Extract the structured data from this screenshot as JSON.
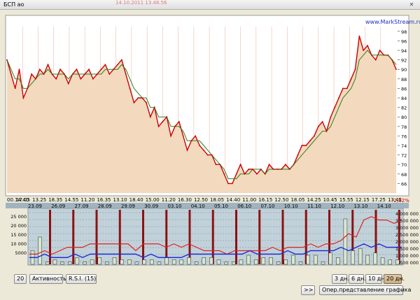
{
  "window": {
    "title": "БСП ао",
    "subtitle": "14.10.2011  13.48.56"
  },
  "brand": "www.MarkStream.ru",
  "colors": {
    "price_fill": "#f3d9bd",
    "price_line": "#cc0000",
    "ma_line": "#2e7d1e",
    "panel_bg": "#bfd0d8",
    "vol_line": "#1f2fd6",
    "act_line": "#e02020"
  },
  "price_chart": {
    "y_ticks": [
      "98",
      "96",
      "94",
      "92",
      "90",
      "88",
      "86",
      "84",
      "82",
      "80",
      "78",
      "76",
      "74",
      "72",
      "70",
      "68",
      "66"
    ],
    "x_ticks": [
      "00.14.40",
      "17.05",
      "13.25",
      "18.35",
      "14.55",
      "11.20",
      "16.35",
      "13.10",
      "18.40",
      "15.00",
      "11.20",
      "16.30",
      "12.50",
      "18.05",
      "14.40",
      "11.00",
      "16.15",
      "12.50",
      "18.05",
      "14.25",
      "10.45",
      "15.55",
      "12.15",
      "17.25",
      "13.45"
    ],
    "change_label": "-2,82%"
  },
  "chart_data": {
    "type": "line",
    "title": "",
    "ylim": [
      64,
      99
    ],
    "series": [
      {
        "name": "",
        "values": [
          92,
          89,
          86,
          90,
          84,
          86,
          89,
          88,
          90,
          89,
          91,
          89,
          88,
          90,
          89,
          87,
          89,
          90,
          88,
          89,
          90,
          88,
          89,
          90,
          91,
          89,
          90,
          91,
          92,
          89,
          86,
          83,
          84,
          84,
          83,
          80,
          82,
          78,
          79,
          80,
          76,
          78,
          79,
          76,
          73,
          75,
          76,
          74,
          73,
          72,
          72,
          70,
          70,
          68,
          66,
          66,
          68,
          70,
          68,
          69,
          69,
          68,
          69,
          68,
          70,
          69,
          69,
          69,
          70,
          69,
          70,
          72,
          74,
          74,
          75,
          76,
          78,
          79,
          77,
          80,
          82,
          84,
          86,
          86,
          88,
          90,
          97,
          94,
          95,
          93,
          92,
          94,
          93,
          93,
          92,
          90
        ]
      },
      {
        "name": "",
        "values": [
          92,
          90,
          88,
          88,
          86,
          86,
          87,
          88,
          89,
          89,
          90,
          89,
          89,
          89,
          89,
          88,
          89,
          89,
          89,
          89,
          89,
          89,
          89,
          89,
          90,
          90,
          90,
          90,
          91,
          90,
          88,
          86,
          85,
          84,
          84,
          82,
          82,
          80,
          80,
          80,
          78,
          78,
          78,
          77,
          75,
          75,
          75,
          75,
          74,
          73,
          72,
          71,
          70,
          69,
          67,
          67,
          67,
          68,
          68,
          68,
          69,
          69,
          69,
          68,
          69,
          69,
          69,
          69,
          69,
          69,
          70,
          71,
          72,
          73,
          74,
          75,
          76,
          77,
          77,
          78,
          80,
          82,
          84,
          85,
          86,
          88,
          92,
          93,
          94,
          93,
          93,
          93,
          93,
          93,
          92,
          91
        ]
      }
    ],
    "lower_panel": {
      "dates": [
        "23.09",
        "26.09",
        "27.09",
        "28.09",
        "29.09",
        "30.09",
        "03.10",
        "04.10",
        "05.10",
        "06.10",
        "07.10",
        "10.10",
        "11.10",
        "12.10",
        "13.10",
        "14.10"
      ],
      "left_ticks": [
        "25 000",
        "20 000",
        "15 000",
        "10 000",
        "5000"
      ],
      "right_ticks": [
        "4 000 000",
        "3 500 000",
        "3 000 000",
        "2 500 000",
        "2 000 000",
        "1 500 000",
        "1 000 000",
        "500 000"
      ],
      "activity": [
        3,
        3,
        4,
        3,
        4,
        5,
        5,
        5,
        6,
        6,
        6,
        6,
        6,
        6,
        4,
        6,
        6,
        6,
        5,
        6,
        5,
        6,
        5,
        4,
        4,
        4,
        3,
        4,
        4,
        4,
        4,
        4,
        5,
        4,
        5,
        5,
        5,
        6,
        5,
        6,
        6,
        7,
        9,
        8,
        13,
        14,
        13,
        13,
        12,
        13
      ],
      "volume_line": [
        2,
        2,
        3,
        2,
        2,
        2,
        3,
        2,
        3,
        3,
        3,
        3,
        3,
        3,
        3,
        2,
        3,
        2,
        2,
        2,
        2,
        3,
        3,
        3,
        3,
        3,
        3,
        3,
        3,
        4,
        3,
        3,
        3,
        3,
        4,
        3,
        3,
        4,
        4,
        4,
        4,
        5,
        4,
        5,
        6,
        5,
        6,
        5,
        5,
        5
      ],
      "bars": [
        6,
        12,
        1,
        2,
        1,
        1,
        3,
        1,
        2,
        3,
        1,
        3,
        2,
        2,
        1,
        2,
        2,
        1,
        3,
        2,
        2,
        3,
        1,
        3,
        3,
        2,
        1,
        1,
        2,
        4,
        2,
        3,
        3,
        1,
        2,
        4,
        1,
        4,
        4,
        1,
        5,
        3,
        20,
        6,
        7,
        4,
        5,
        3,
        2,
        2
      ]
    }
  },
  "controls": {
    "period_value": "20",
    "activity_label": "Активность",
    "rsi_label": "R.S.I. (15)",
    "range_buttons": [
      "3 дн.",
      "6 дн.",
      "10 дн.",
      "20 дн."
    ],
    "scroll_label": ">>",
    "view_button": "Опер.представление графика"
  }
}
